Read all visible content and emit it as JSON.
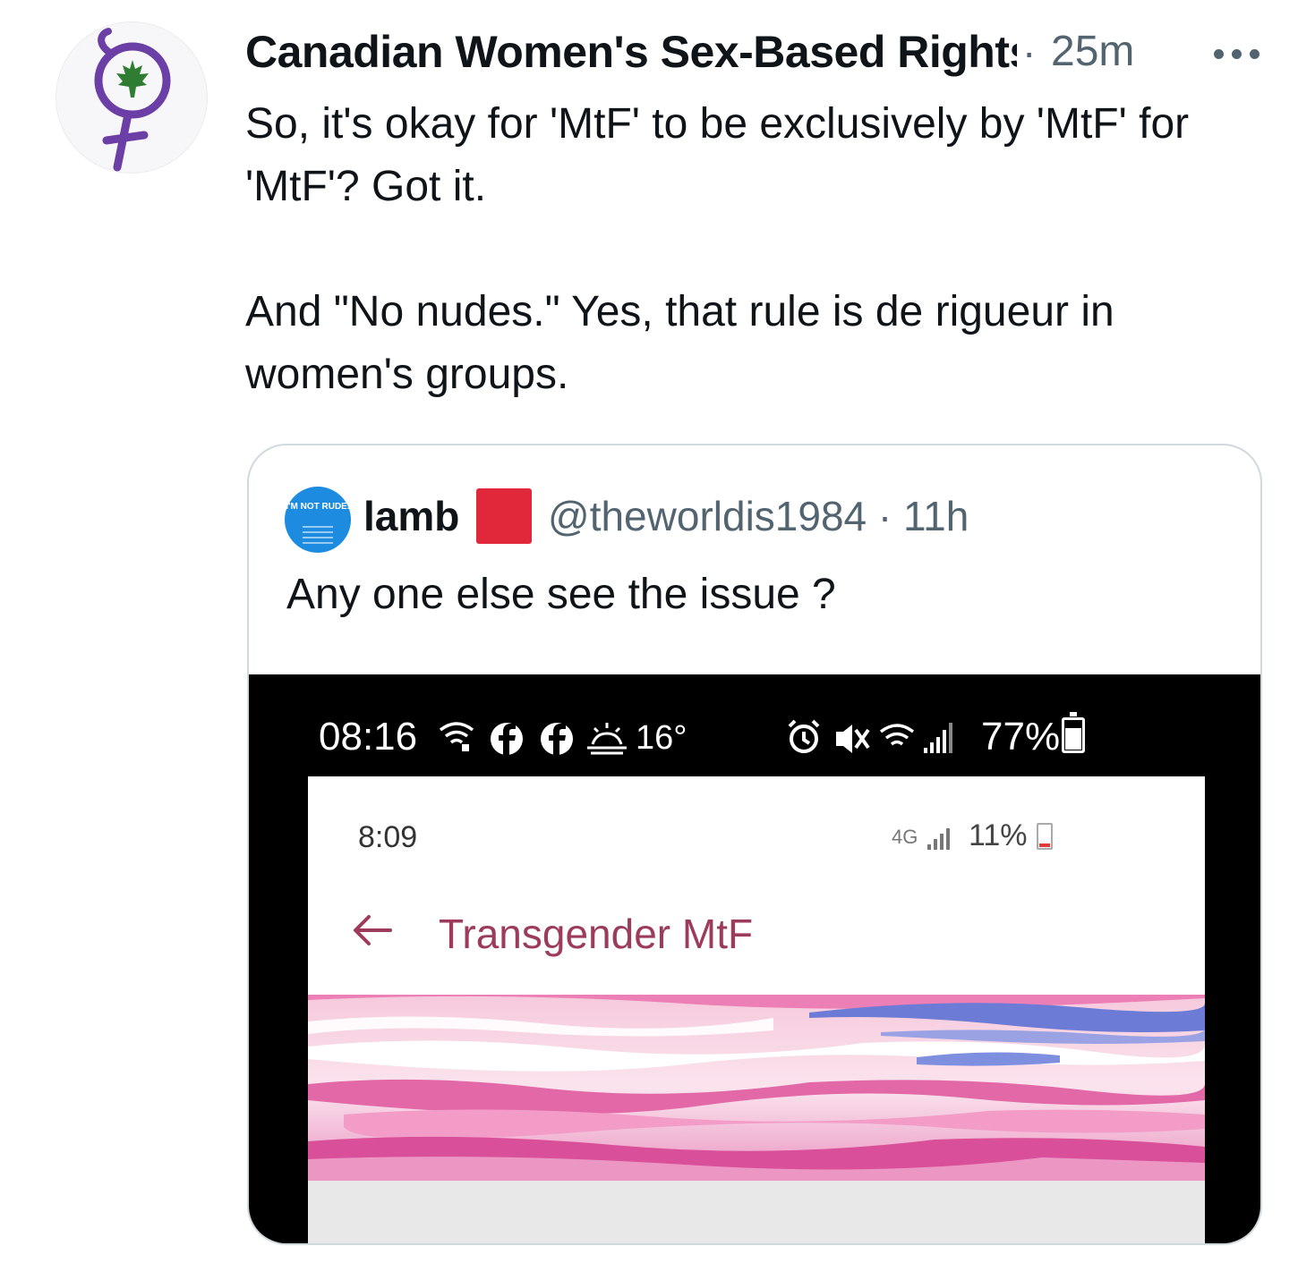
{
  "tweet": {
    "author_name": "Canadian Women's Sex-Based Rights",
    "separator": "·",
    "timestamp": "25m",
    "text": "So, it's okay for 'MtF' to be exclusively by 'MtF' for 'MtF'? Got it.\n\nAnd \"No nudes.\" Yes, that rule is de rigueur in women's groups."
  },
  "quoted_tweet": {
    "avatar_text": "I'M NOT RUDE.",
    "author_name": "lamb",
    "handle_and_time": "@theworldis1984 · 11h",
    "text": "Any one else see the issue ?",
    "screenshot": {
      "status_time": "08:16",
      "temperature": "16°",
      "battery": "77%",
      "inner_status_time": "8:09",
      "inner_network": "4G",
      "inner_battery": "11%",
      "group_title": "Transgender MtF"
    }
  },
  "colors": {
    "accent_purple": "#6b3fa6",
    "maple_green": "#2e7d32",
    "quote_avatar_blue": "#1d8ce0",
    "flag_red": "#e0283a",
    "group_title_color": "#9c3b5b"
  },
  "icons": [
    "venus-symbol-logo",
    "maple-leaf-icon",
    "more-options-icon",
    "wifi-icon",
    "facebook-icon",
    "sun-cloud-icon",
    "alarm-icon",
    "mute-icon",
    "signal-icon",
    "battery-icon",
    "back-arrow-icon"
  ]
}
